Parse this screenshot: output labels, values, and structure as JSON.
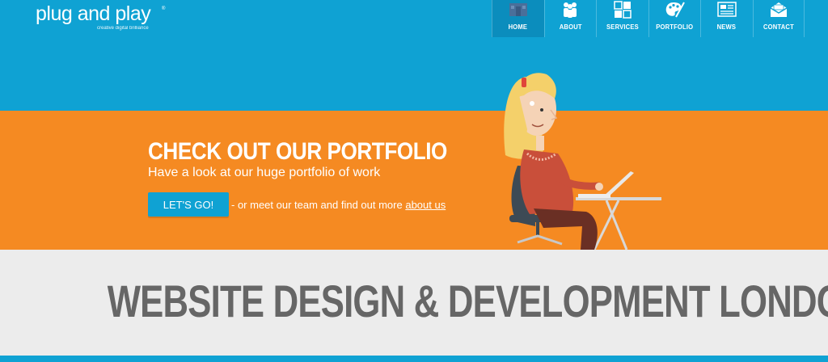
{
  "logo": {
    "text": "plug and play",
    "tm": "®",
    "tagline": "creative digital brilliance"
  },
  "nav": {
    "items": [
      {
        "label": "HOME",
        "icon": "home-icon",
        "active": true
      },
      {
        "label": "ABOUT",
        "icon": "people-icon",
        "active": false
      },
      {
        "label": "SERVICES",
        "icon": "grid-icon",
        "active": false
      },
      {
        "label": "PORTFOLIO",
        "icon": "palette-icon",
        "active": false
      },
      {
        "label": "NEWS",
        "icon": "newspaper-icon",
        "active": false
      },
      {
        "label": "CONTACT",
        "icon": "envelope-icon",
        "active": false
      }
    ]
  },
  "hero": {
    "title": "CHECK OUT OUR PORTFOLIO",
    "subtitle": "Have a look at our huge portfolio of work",
    "cta_label": "LET'S GO!",
    "more_text": "- or meet our team and find out more",
    "more_link": "about us"
  },
  "tagline": "WEBSITE DESIGN & DEVELOPMENT LONDON",
  "colors": {
    "blue": "#0fa2d3",
    "orange": "#f58a22",
    "grey_band": "#ececec",
    "tagline": "#666666"
  }
}
